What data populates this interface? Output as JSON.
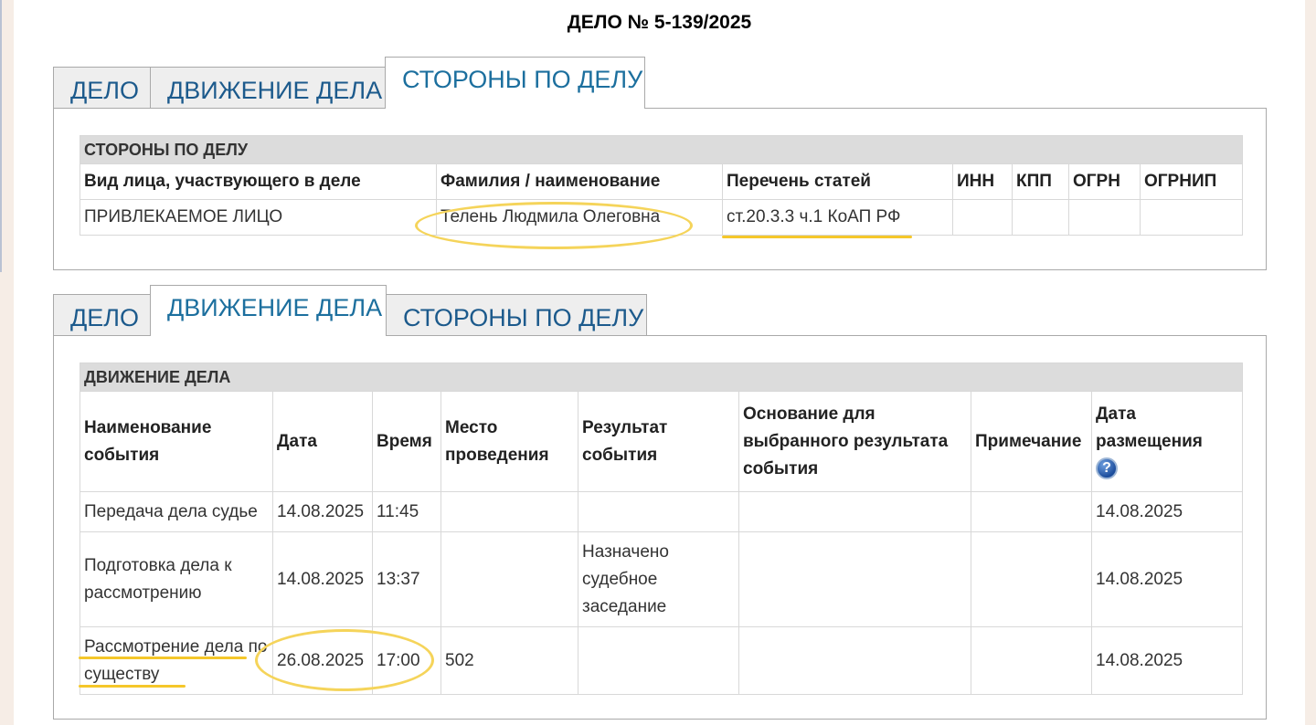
{
  "case": {
    "title": "ДЕЛО № 5-139/2025"
  },
  "tabs": {
    "case": "ДЕЛО",
    "movement": "ДВИЖЕНИЕ ДЕЛА",
    "parties": "СТОРОНЫ ПО ДЕЛУ"
  },
  "parties": {
    "caption": "СТОРОНЫ ПО ДЕЛУ",
    "headers": [
      "Вид лица, участвующего в деле",
      "Фамилия / наименование",
      "Перечень статей",
      "ИНН",
      "КПП",
      "ОГРН",
      "ОГРНИП"
    ],
    "rows": [
      [
        "ПРИВЛЕКАЕМОЕ ЛИЦО",
        "Телень Людмила Олеговна",
        "ст.20.3.3 ч.1 КоАП РФ",
        "",
        "",
        "",
        ""
      ]
    ]
  },
  "movement": {
    "caption": "ДВИЖЕНИЕ ДЕЛА",
    "headers": [
      "Наименование события",
      "Дата",
      "Время",
      "Место проведения",
      "Результат события",
      "Основание для выбранного результата события",
      "Примечание",
      "Дата размещения"
    ],
    "help_icon": "help-question-icon",
    "rows": [
      [
        "Передача дела судье",
        "14.08.2025",
        "11:45",
        "",
        "",
        "",
        "",
        "14.08.2025"
      ],
      [
        "Подготовка дела к рассмотрению",
        "14.08.2025",
        "13:37",
        "",
        "Назначено судебное заседание",
        "",
        "",
        "14.08.2025"
      ],
      [
        "Рассмотрение дела по существу",
        "26.08.2025",
        "17:00",
        "502",
        "",
        "",
        "",
        "14.08.2025"
      ]
    ]
  },
  "colors": {
    "tab_text": "#1c5a8c",
    "highlight": "#f5d45a",
    "caption_bg": "#dcdcdc"
  }
}
